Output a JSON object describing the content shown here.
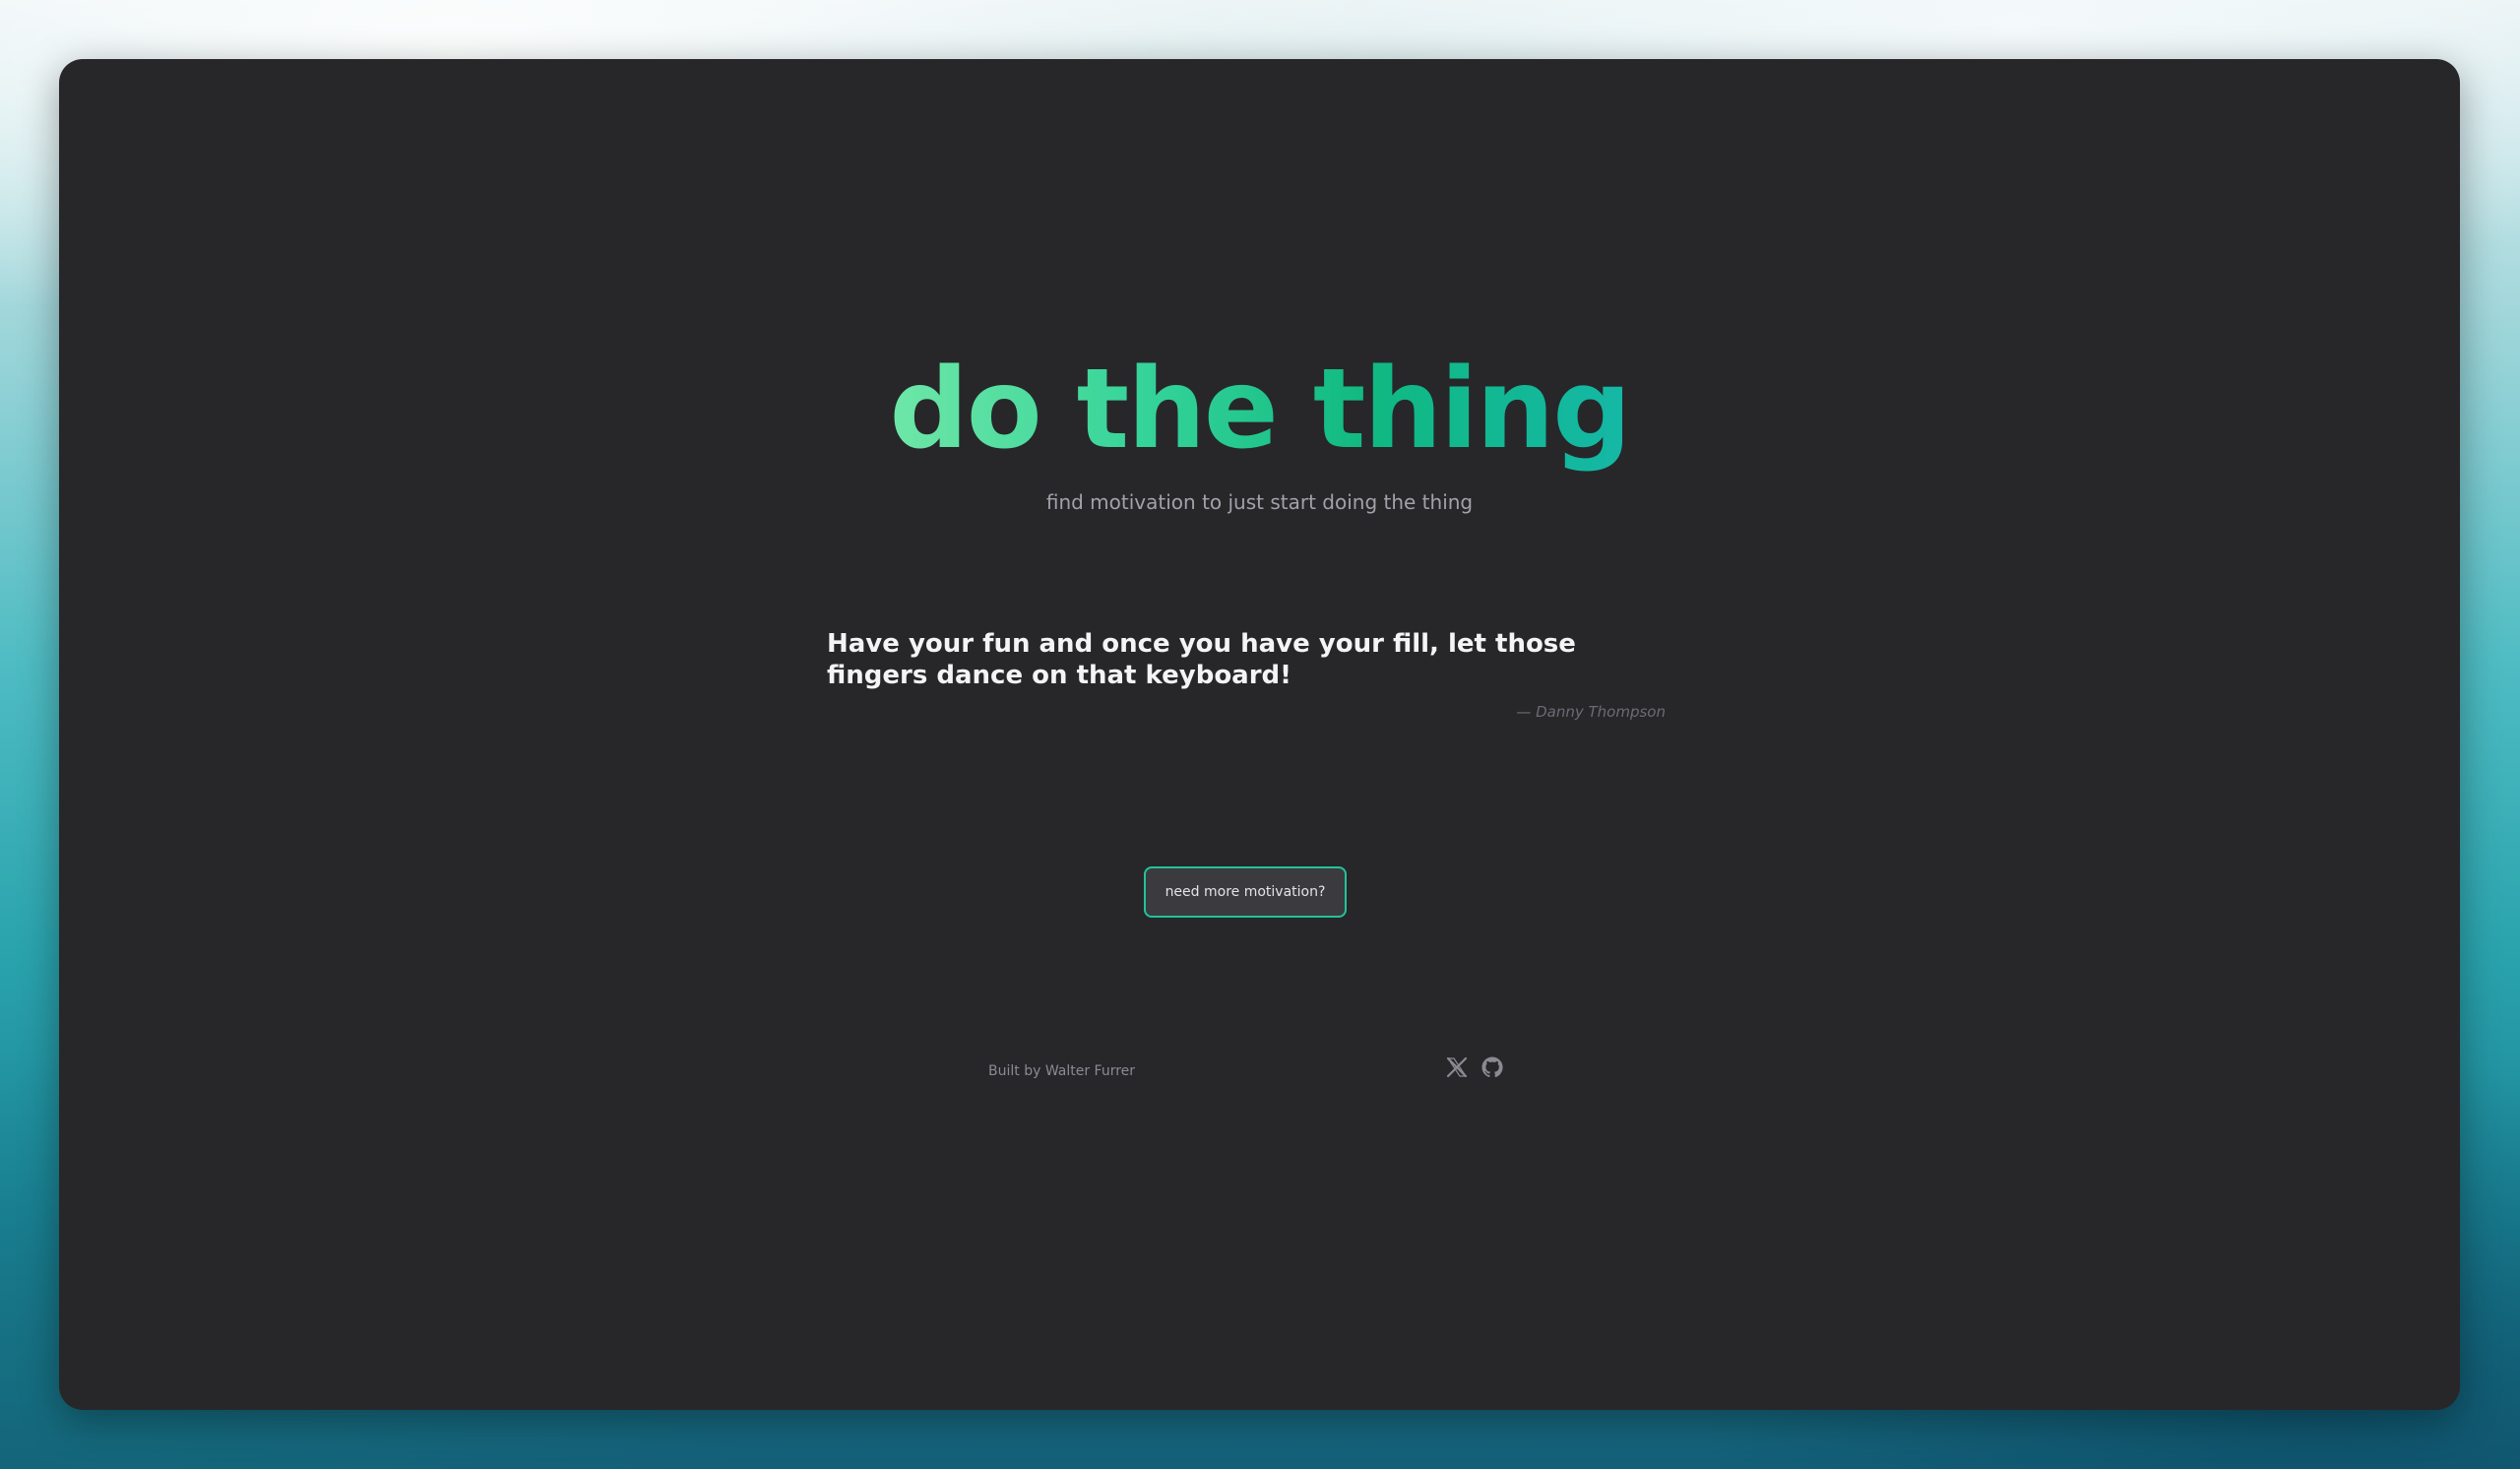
{
  "header": {
    "title": "do the thing",
    "subtitle": "find motivation to just start doing the thing"
  },
  "quote": {
    "text": "Have your fun and once you have your fill, let those fingers dance on that keyboard!",
    "author": "— Danny Thompson"
  },
  "actions": {
    "more_motivation_label": "need more motivation?"
  },
  "footer": {
    "credit": "Built by Walter Furrer",
    "icons": [
      "x-twitter-icon",
      "github-icon"
    ]
  },
  "colors": {
    "background": "#27272a",
    "accent_start": "#6ee7a7",
    "accent_end": "#14b8a6",
    "button_border": "#22c39a"
  }
}
